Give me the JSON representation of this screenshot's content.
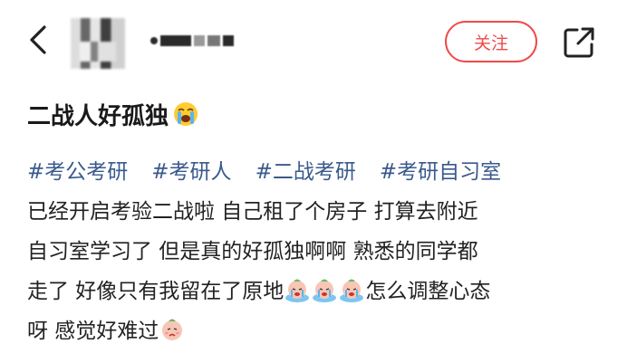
{
  "header": {
    "back_icon": "chevron-left-icon",
    "follow_label": "关注",
    "share_icon": "share-external-icon",
    "accent_color": "#f04a4a"
  },
  "post": {
    "title": "二战人好孤独",
    "title_emoji": "loudly-crying-face",
    "tags": [
      "#考公考研",
      "#考研人",
      "#二战考研",
      "#考研自习室"
    ],
    "lines": [
      "已经开启考验二战啦 自己租了个房子 打算去附近",
      "自习室学习了 但是真的好孤独啊啊 熟悉的同学都",
      "走了 好像只有我留在了原地",
      "怎么调整心态",
      "呀 感觉好难过"
    ],
    "inline_sticker": "crying-peach-sticker",
    "tag_color": "#3a5a8c"
  }
}
